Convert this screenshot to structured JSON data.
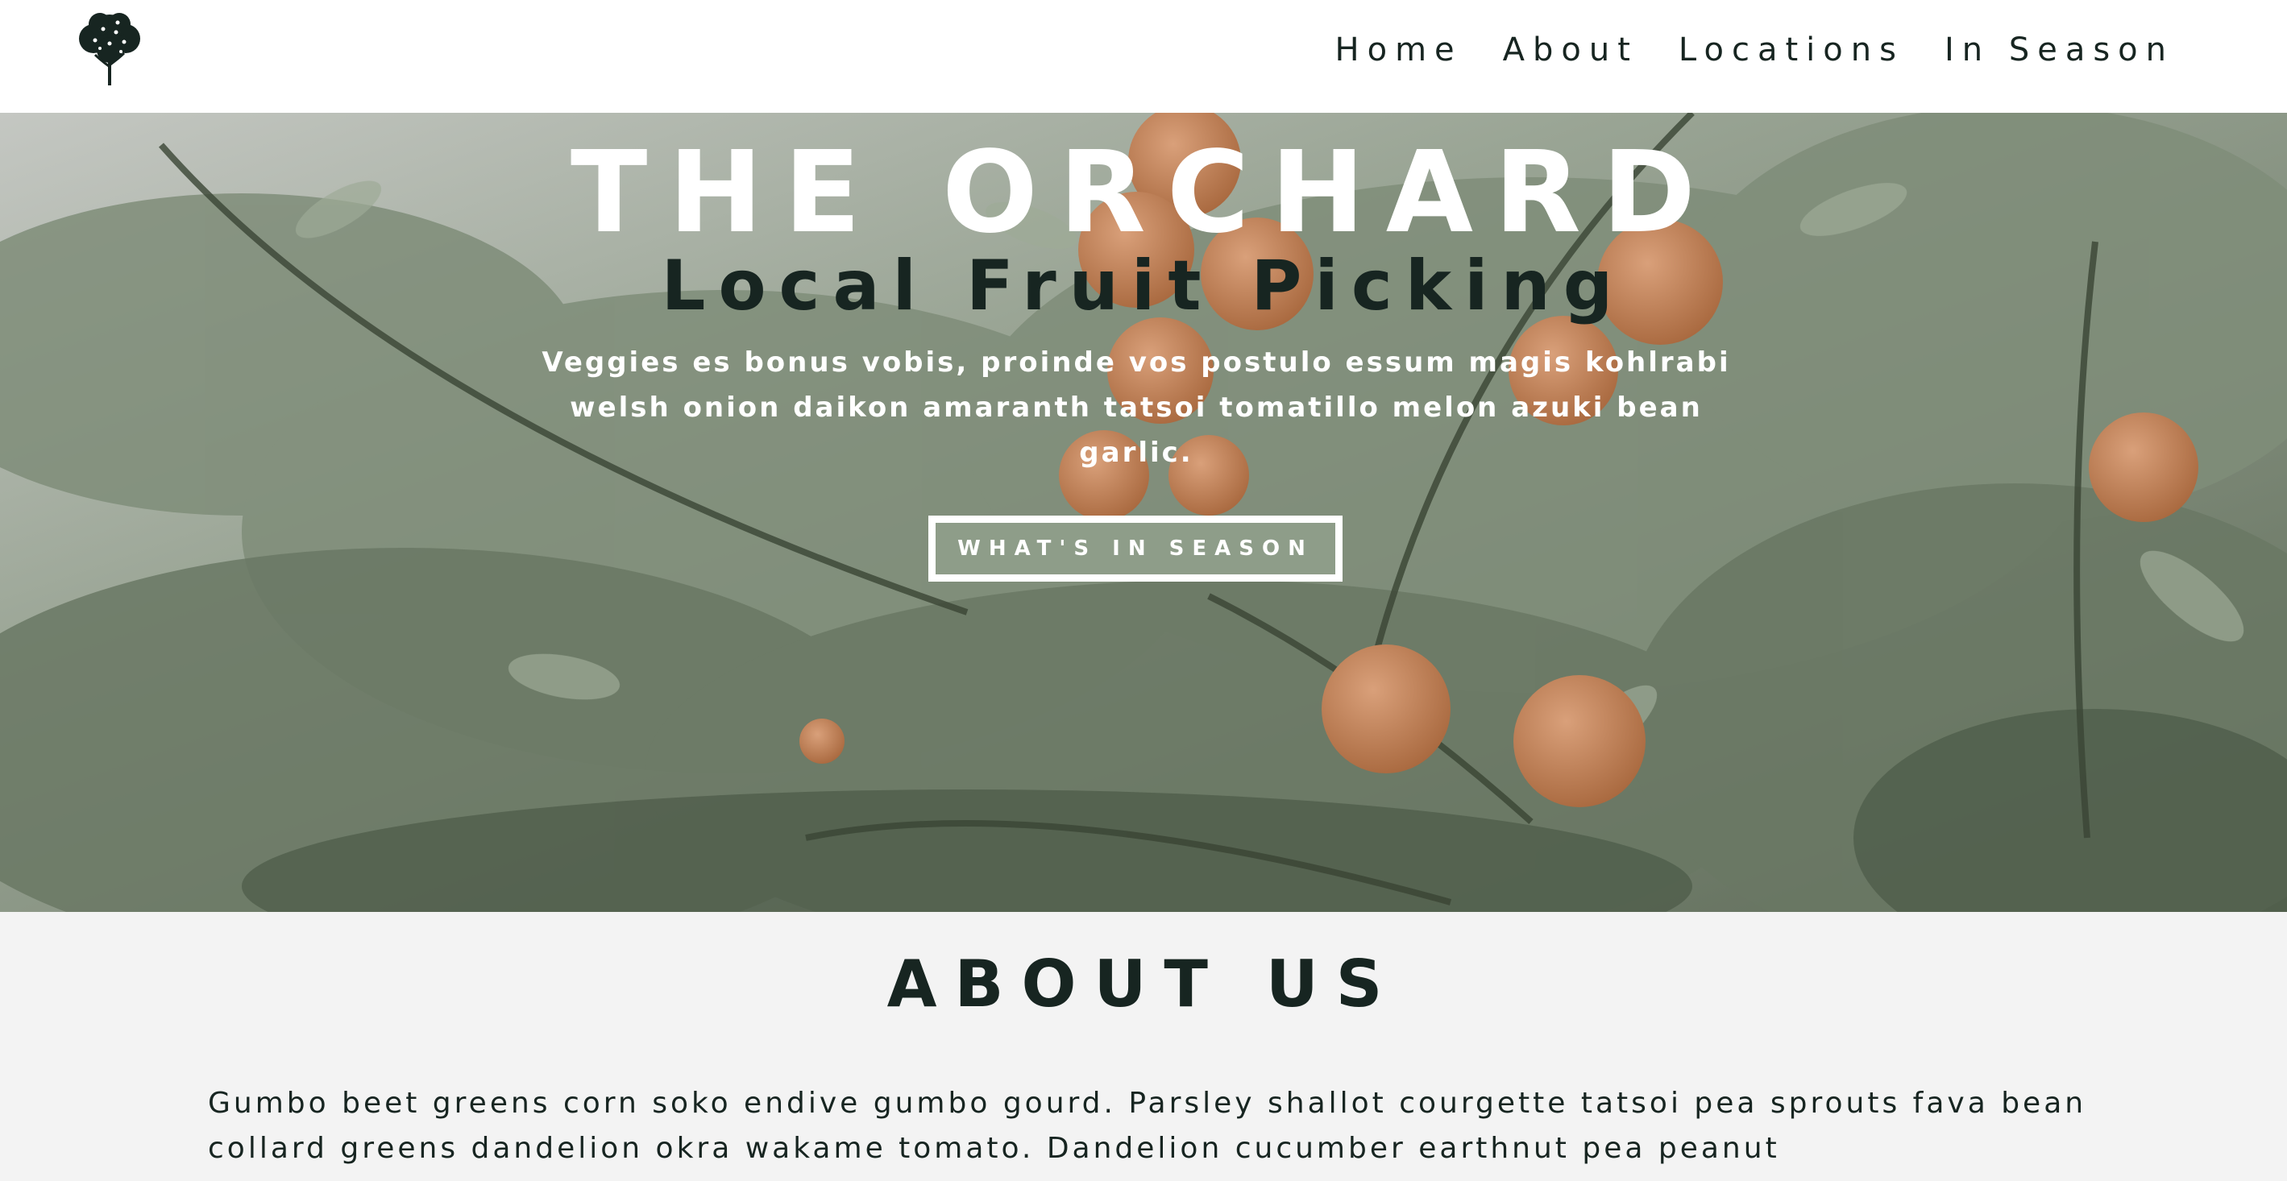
{
  "header": {
    "logo_icon": "tree-icon",
    "nav": [
      {
        "label": "Home"
      },
      {
        "label": "About"
      },
      {
        "label": "Locations"
      },
      {
        "label": "In Season"
      }
    ]
  },
  "hero": {
    "title": "THE ORCHARD",
    "subtitle": "Local Fruit Picking",
    "text": "Veggies es bonus vobis, proinde vos postulo essum magis kohlrabi welsh onion daikon amaranth tatsoi tomatillo melon azuki bean garlic.",
    "button_label": "WHAT'S IN SEASON"
  },
  "about": {
    "heading": "ABOUT US",
    "text": "Gumbo beet greens corn soko endive gumbo gourd. Parsley shallot courgette tatsoi pea sprouts fava bean collard greens dandelion okra wakame tomato. Dandelion cucumber earthnut pea peanut"
  },
  "colors": {
    "dark_text": "#172521",
    "button_fill": "#8e9d89",
    "hero_tint": "#8c9886",
    "fruit": "#c98a5a"
  }
}
